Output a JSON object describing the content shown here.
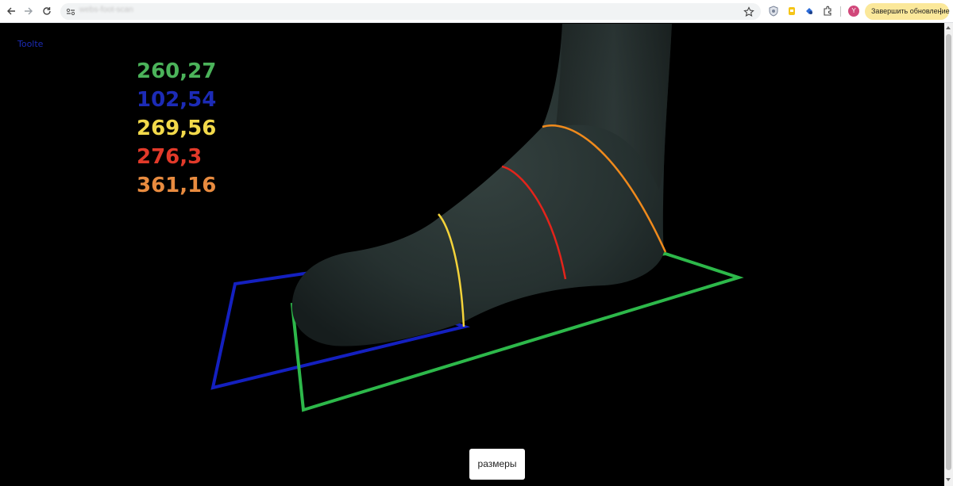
{
  "browser": {
    "url": "webs-foot-scan",
    "update_button": "Завершить обновление",
    "avatar_letter": "Y",
    "icons": [
      "back-icon",
      "forward-icon",
      "reload-icon",
      "site-info-icon",
      "bookmark-star-icon",
      "shield-extension-icon",
      "yellow-extension-icon",
      "blue-extension-icon",
      "puzzle-extensions-icon",
      "more-icon"
    ]
  },
  "scene": {
    "corner_label": "Toolte",
    "measurements": [
      {
        "value": "260,27",
        "color": "#4bb35a"
      },
      {
        "value": "102,54",
        "color": "#1c2bb6"
      },
      {
        "value": "269,56",
        "color": "#f2d94a"
      },
      {
        "value": "276,3",
        "color": "#e23a2a"
      },
      {
        "value": "361,16",
        "color": "#e88b3f"
      }
    ],
    "sizes_button": "размеры"
  }
}
